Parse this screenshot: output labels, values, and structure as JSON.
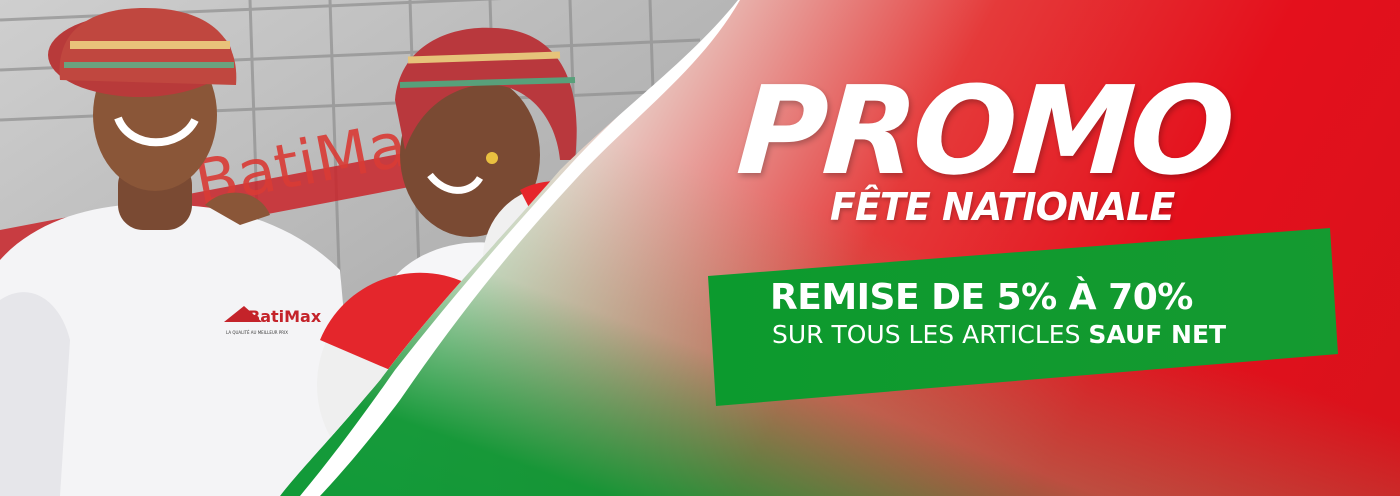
{
  "banner": {
    "title": "PROMO",
    "subtitle": "FÊTE NATIONALE",
    "discount_line": "REMISE DE 5% À 70%",
    "conditions_line": "SUR TOUS LES ARTICLES",
    "conditions_emphasis": "SAUF NET",
    "shirt_brand": "BatiMax",
    "shirt_tagline": "LA QUALITÉ AU MEILLEUR PRIX",
    "building_sign": "BatiMax"
  },
  "colors": {
    "red": "#e4101c",
    "green": "#0b9a36",
    "white": "#ffffff"
  }
}
